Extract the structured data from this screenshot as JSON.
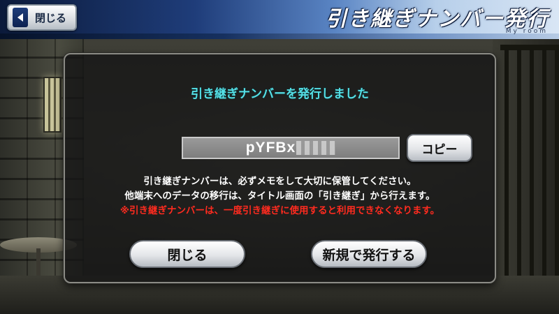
{
  "header": {
    "back_label": "閉じる",
    "title": "引き継ぎナンバー発行",
    "subtitle": "My room"
  },
  "dialog": {
    "title": "引き継ぎナンバーを発行しました",
    "code_visible": "pYFBx",
    "copy_label": "コピー",
    "messages": [
      "引き継ぎナンバーは、必ずメモをして大切に保管してください。",
      "他端末へのデータの移行は、タイトル画面の「引き継ぎ」から行えます。",
      "※引き継ぎナンバーは、一度引き継ぎに使用すると利用できなくなります。"
    ],
    "close_label": "閉じる",
    "reissue_label": "新規で発行する"
  },
  "colors": {
    "title_cyan": "#55e0e6",
    "warning_red": "#ff2b1f",
    "header_blue": "#1f3d7a"
  }
}
